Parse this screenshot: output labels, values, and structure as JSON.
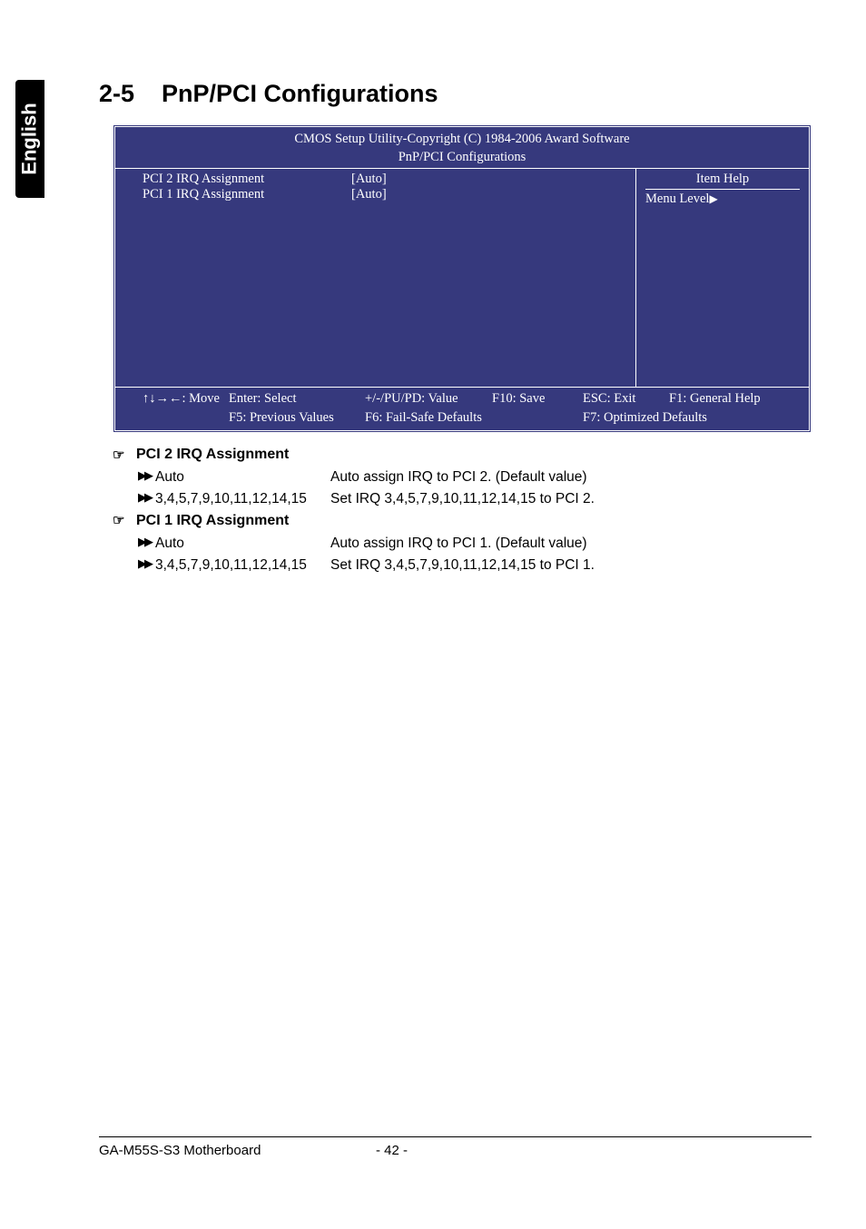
{
  "sideTab": "English",
  "section": {
    "num": "2-5",
    "title": "PnP/PCI Configurations"
  },
  "bios": {
    "header1": "CMOS Setup Utility-Copyright (C) 1984-2006 Award Software",
    "header2": "PnP/PCI Configurations",
    "rows": [
      {
        "label": "PCI 2 IRQ Assignment",
        "value": "[Auto]"
      },
      {
        "label": "PCI 1 IRQ Assignment",
        "value": "[Auto]"
      }
    ],
    "rightHeader": "Item Help",
    "rightLine": "Menu Level",
    "footer": {
      "r1c1": "↑↓→←: Move",
      "r1c2": "Enter: Select",
      "r1c3": "+/-/PU/PD: Value",
      "r1c4": "F10: Save",
      "r1c5": "ESC: Exit",
      "r1c6": "F1: General Help",
      "r2c1": "",
      "r2c2": "F5: Previous Values",
      "r2c3": "F6: Fail-Safe Defaults",
      "r2c4": "",
      "r2c5": "F7: Optimized Defaults",
      "r2c6": ""
    }
  },
  "help": [
    {
      "heading": "PCI 2 IRQ Assignment",
      "items": [
        {
          "key": "Auto",
          "desc": "Auto assign IRQ to PCI 2. (Default value)"
        },
        {
          "key": "3,4,5,7,9,10,11,12,14,15",
          "desc": "Set IRQ 3,4,5,7,9,10,11,12,14,15 to PCI 2."
        }
      ]
    },
    {
      "heading": "PCI 1 IRQ Assignment",
      "items": [
        {
          "key": "Auto",
          "desc": "Auto assign IRQ to PCI 1. (Default value)"
        },
        {
          "key": "3,4,5,7,9,10,11,12,14,15",
          "desc": "Set IRQ 3,4,5,7,9,10,11,12,14,15 to PCI 1."
        }
      ]
    }
  ],
  "pageFooter": {
    "product": "GA-M55S-S3 Motherboard",
    "page": "- 42 -"
  }
}
